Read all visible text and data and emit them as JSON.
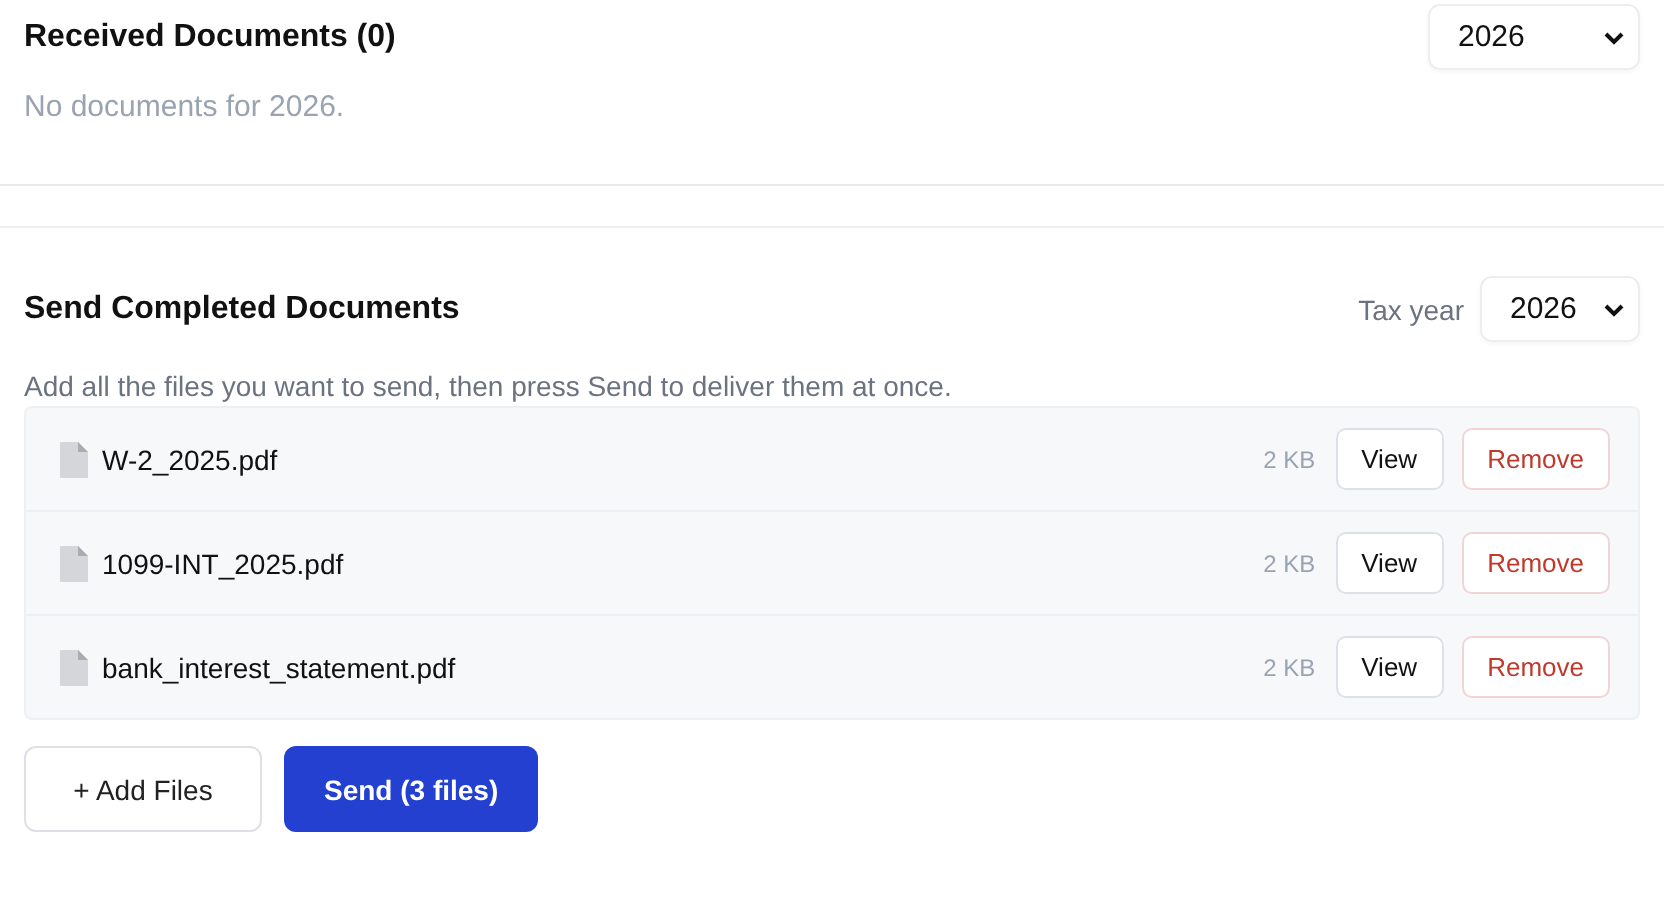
{
  "received": {
    "title": "Received Documents (0)",
    "year": "2026",
    "empty_message": "No documents for 2026."
  },
  "send": {
    "title": "Send Completed Documents",
    "year_label": "Tax year",
    "year": "2026",
    "description": "Add all the files you want to send, then press Send to deliver them at once.",
    "files": [
      {
        "name": "W-2_2025.pdf",
        "size": "2 KB",
        "view": "View",
        "remove": "Remove"
      },
      {
        "name": "1099-INT_2025.pdf",
        "size": "2 KB",
        "view": "View",
        "remove": "Remove"
      },
      {
        "name": "bank_interest_statement.pdf",
        "size": "2 KB",
        "view": "View",
        "remove": "Remove"
      }
    ],
    "add_button": "+ Add Files",
    "send_button": "Send (3 files)"
  }
}
